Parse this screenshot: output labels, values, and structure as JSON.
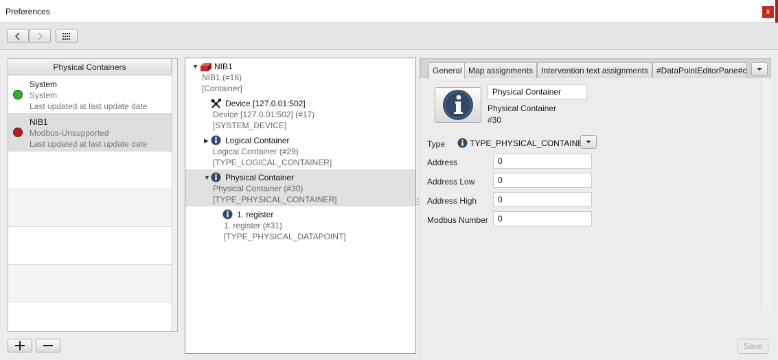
{
  "window": {
    "title": "Preferences",
    "close_label": "x"
  },
  "left_panel": {
    "header": "Physical Containers",
    "items": [
      {
        "name": "System",
        "subtitle": "System",
        "updated": "Last updated at last update date",
        "status_color": "#22bb22"
      },
      {
        "name": "NIB1",
        "subtitle": "Modbus-Unsupported",
        "updated": "Last updated at last update date",
        "status_color": "#cc1111"
      }
    ]
  },
  "tree": {
    "nodes": [
      {
        "label": "NIB1",
        "detail": "NIB1 (#16)",
        "type": "[Container]",
        "icon": "brick-icon"
      },
      {
        "label": "Device [127.0.01:502]",
        "detail": "Device [127.0.01:502] (#17)",
        "type": "[SYSTEM_DEVICE]",
        "icon": "tools-icon"
      },
      {
        "label": "Logical Container",
        "detail": "Logical Container (#29)",
        "type": "[TYPE_LOGICAL_CONTAINER]",
        "icon": "info-icon"
      },
      {
        "label": "Physical Container",
        "detail": "Physical Container (#30)",
        "type": "[TYPE_PHYSICAL_CONTAINER]",
        "icon": "info-icon"
      },
      {
        "label": "1. register",
        "detail": "1. register (#31)",
        "type": "[TYPE_PHYSICAL_DATAPOINT]",
        "icon": "info-icon"
      }
    ]
  },
  "tabs": [
    "General",
    "Map assignments",
    "Intervention text assignments",
    "#DataPointEditorPane#c"
  ],
  "general": {
    "name_value": "Physical Container",
    "type_name": "Physical Container",
    "id": "#30",
    "type_label": "Type",
    "type_value": "TYPE_PHYSICAL_CONTAINER",
    "fields": [
      {
        "label": "Address",
        "value": "0"
      },
      {
        "label": "Address Low",
        "value": "0"
      },
      {
        "label": "Address High",
        "value": "0"
      },
      {
        "label": "Modbus Number",
        "value": "0"
      }
    ],
    "save_label": "Save"
  }
}
